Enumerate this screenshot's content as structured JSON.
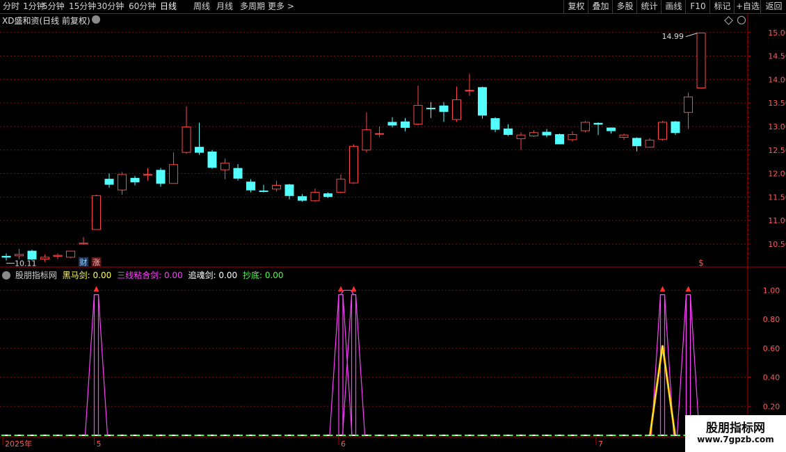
{
  "toolbar": {
    "periods": [
      "分时",
      "1分钟",
      "5分钟",
      "15分钟",
      "30分钟",
      "60分钟",
      "日线",
      "周线",
      "月线",
      "多周期",
      "更多 >"
    ],
    "active_period": "日线",
    "right_buttons": [
      "复权",
      "叠加",
      "多股",
      "统计",
      "画线",
      "F10",
      "标记",
      "+自选",
      "返回"
    ]
  },
  "stock_title": "XD盛和资(日线 前复权)",
  "colors": {
    "up": "#ff4545",
    "down": "#54ffff",
    "grid": "#7a0f0f",
    "axis": "#b00000",
    "heima": "#ffff50",
    "sanxian": "#ff40ff",
    "zhuihun": "#ffffff",
    "chaodi": "#46ff46"
  },
  "icons": [
    "chevron-down-icon",
    "diamond-icon",
    "circle-icon",
    "red-arrow-icon"
  ],
  "price_labels": {
    "high": "14.99",
    "low": "10.11"
  },
  "event_markers": [
    {
      "text": "财",
      "index": 6
    },
    {
      "text": "涨",
      "index": 7
    },
    {
      "text": "$",
      "index": 54
    }
  ],
  "indicator": {
    "name": "股朋指标网",
    "fields": [
      {
        "label": "黑马剑:",
        "value": "0.00"
      },
      {
        "label": "三线粘合剑:",
        "value": "0.00"
      },
      {
        "label": "追魂剑:",
        "value": "0.00"
      },
      {
        "label": "抄底:",
        "value": "0.00"
      }
    ],
    "signal_indices_sanxian": [
      7,
      26,
      27,
      51,
      53
    ],
    "signal_indices_heima": [
      51
    ],
    "arrow_indices": [
      7,
      26,
      27,
      51,
      53
    ]
  },
  "watermark": {
    "line1": "股朋指标网",
    "line2": "www.7gpzb.com"
  },
  "chart_data": {
    "type": "candlestick",
    "ylim": [
      10.1,
      15.1
    ],
    "yticks": [
      "15.00",
      "14.50",
      "14.00",
      "13.50",
      "13.00",
      "12.50",
      "12.00",
      "11.50",
      "11.00",
      "10.50"
    ],
    "indicator_yticks": [
      "1.00",
      "0.80",
      "0.60",
      "0.40",
      "0.20"
    ],
    "indicator_ylim": [
      0,
      1.05
    ],
    "x_labels": [
      {
        "text": "2025年",
        "index": 0
      },
      {
        "text": "5",
        "index": 7
      },
      {
        "text": "6",
        "index": 26
      },
      {
        "text": "7",
        "index": 46
      }
    ],
    "candles": [
      [
        10.24,
        10.22,
        10.3,
        10.15
      ],
      [
        10.25,
        10.28,
        10.4,
        10.18
      ],
      [
        10.35,
        10.18,
        10.38,
        10.15
      ],
      [
        10.18,
        10.22,
        10.28,
        10.12
      ],
      [
        10.24,
        10.26,
        10.3,
        10.18
      ],
      [
        10.22,
        10.35,
        10.36,
        10.2
      ],
      [
        10.5,
        10.52,
        10.65,
        10.48
      ],
      [
        10.81,
        11.53,
        11.55,
        10.8
      ],
      [
        11.88,
        11.77,
        12.0,
        11.7
      ],
      [
        11.65,
        11.98,
        12.03,
        11.55
      ],
      [
        11.9,
        11.82,
        11.95,
        11.75
      ],
      [
        11.98,
        11.98,
        12.12,
        11.85
      ],
      [
        12.07,
        11.79,
        12.12,
        11.72
      ],
      [
        11.79,
        12.19,
        12.45,
        11.78
      ],
      [
        12.45,
        12.99,
        13.43,
        12.42
      ],
      [
        12.56,
        12.45,
        13.08,
        12.4
      ],
      [
        12.46,
        12.13,
        12.5,
        12.1
      ],
      [
        12.08,
        12.22,
        12.32,
        11.88
      ],
      [
        12.11,
        11.9,
        12.2,
        11.85
      ],
      [
        11.82,
        11.65,
        11.88,
        11.6
      ],
      [
        11.63,
        11.62,
        11.76,
        11.6
      ],
      [
        11.67,
        11.75,
        11.85,
        11.62
      ],
      [
        11.76,
        11.53,
        11.78,
        11.45
      ],
      [
        11.51,
        11.43,
        11.56,
        11.4
      ],
      [
        11.42,
        11.6,
        11.68,
        11.4
      ],
      [
        11.57,
        11.51,
        11.6,
        11.48
      ],
      [
        11.6,
        11.88,
        11.98,
        11.58
      ],
      [
        11.8,
        12.58,
        12.62,
        11.78
      ],
      [
        12.5,
        12.93,
        13.3,
        12.45
      ],
      [
        12.85,
        12.85,
        13.0,
        12.78
      ],
      [
        13.09,
        13.03,
        13.2,
        12.98
      ],
      [
        13.1,
        12.98,
        13.18,
        12.9
      ],
      [
        13.05,
        13.45,
        13.87,
        13.03
      ],
      [
        13.39,
        13.38,
        13.52,
        13.18
      ],
      [
        13.44,
        13.32,
        13.52,
        13.1
      ],
      [
        13.15,
        13.57,
        13.85,
        13.1
      ],
      [
        13.77,
        13.77,
        14.12,
        13.65
      ],
      [
        13.83,
        13.24,
        13.85,
        13.17
      ],
      [
        13.17,
        12.94,
        13.2,
        12.88
      ],
      [
        12.95,
        12.83,
        13.05,
        12.8
      ],
      [
        12.74,
        12.82,
        12.88,
        12.5
      ],
      [
        12.8,
        12.87,
        12.92,
        12.78
      ],
      [
        12.88,
        12.82,
        12.95,
        12.77
      ],
      [
        12.83,
        12.63,
        12.85,
        12.62
      ],
      [
        12.72,
        12.83,
        12.9,
        12.68
      ],
      [
        12.91,
        13.09,
        13.12,
        12.88
      ],
      [
        13.07,
        13.05,
        13.09,
        12.82
      ],
      [
        12.97,
        12.91,
        12.98,
        12.85
      ],
      [
        12.77,
        12.82,
        12.85,
        12.72
      ],
      [
        12.75,
        12.59,
        12.77,
        12.47
      ],
      [
        12.56,
        12.71,
        12.75,
        12.55
      ],
      [
        12.73,
        13.09,
        13.12,
        12.7
      ],
      [
        13.1,
        12.87,
        13.12,
        12.82
      ],
      [
        13.3,
        13.63,
        13.72,
        12.95
      ],
      [
        13.82,
        14.99,
        15.0,
        14.05
      ]
    ]
  }
}
